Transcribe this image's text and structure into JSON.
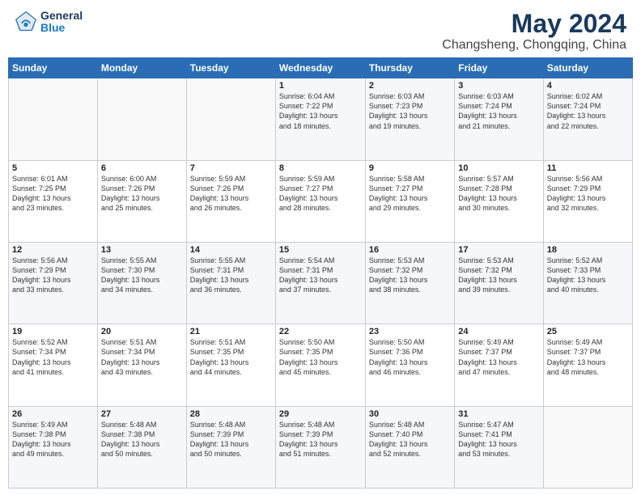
{
  "header": {
    "logo_general": "General",
    "logo_blue": "Blue",
    "month": "May 2024",
    "location": "Changsheng, Chongqing, China"
  },
  "calendar": {
    "weekdays": [
      "Sunday",
      "Monday",
      "Tuesday",
      "Wednesday",
      "Thursday",
      "Friday",
      "Saturday"
    ],
    "weeks": [
      [
        {
          "day": "",
          "info": ""
        },
        {
          "day": "",
          "info": ""
        },
        {
          "day": "",
          "info": ""
        },
        {
          "day": "1",
          "info": "Sunrise: 6:04 AM\nSunset: 7:22 PM\nDaylight: 13 hours\nand 18 minutes."
        },
        {
          "day": "2",
          "info": "Sunrise: 6:03 AM\nSunset: 7:23 PM\nDaylight: 13 hours\nand 19 minutes."
        },
        {
          "day": "3",
          "info": "Sunrise: 6:03 AM\nSunset: 7:24 PM\nDaylight: 13 hours\nand 21 minutes."
        },
        {
          "day": "4",
          "info": "Sunrise: 6:02 AM\nSunset: 7:24 PM\nDaylight: 13 hours\nand 22 minutes."
        }
      ],
      [
        {
          "day": "5",
          "info": "Sunrise: 6:01 AM\nSunset: 7:25 PM\nDaylight: 13 hours\nand 23 minutes."
        },
        {
          "day": "6",
          "info": "Sunrise: 6:00 AM\nSunset: 7:26 PM\nDaylight: 13 hours\nand 25 minutes."
        },
        {
          "day": "7",
          "info": "Sunrise: 5:59 AM\nSunset: 7:26 PM\nDaylight: 13 hours\nand 26 minutes."
        },
        {
          "day": "8",
          "info": "Sunrise: 5:59 AM\nSunset: 7:27 PM\nDaylight: 13 hours\nand 28 minutes."
        },
        {
          "day": "9",
          "info": "Sunrise: 5:58 AM\nSunset: 7:27 PM\nDaylight: 13 hours\nand 29 minutes."
        },
        {
          "day": "10",
          "info": "Sunrise: 5:57 AM\nSunset: 7:28 PM\nDaylight: 13 hours\nand 30 minutes."
        },
        {
          "day": "11",
          "info": "Sunrise: 5:56 AM\nSunset: 7:29 PM\nDaylight: 13 hours\nand 32 minutes."
        }
      ],
      [
        {
          "day": "12",
          "info": "Sunrise: 5:56 AM\nSunset: 7:29 PM\nDaylight: 13 hours\nand 33 minutes."
        },
        {
          "day": "13",
          "info": "Sunrise: 5:55 AM\nSunset: 7:30 PM\nDaylight: 13 hours\nand 34 minutes."
        },
        {
          "day": "14",
          "info": "Sunrise: 5:55 AM\nSunset: 7:31 PM\nDaylight: 13 hours\nand 36 minutes."
        },
        {
          "day": "15",
          "info": "Sunrise: 5:54 AM\nSunset: 7:31 PM\nDaylight: 13 hours\nand 37 minutes."
        },
        {
          "day": "16",
          "info": "Sunrise: 5:53 AM\nSunset: 7:32 PM\nDaylight: 13 hours\nand 38 minutes."
        },
        {
          "day": "17",
          "info": "Sunrise: 5:53 AM\nSunset: 7:32 PM\nDaylight: 13 hours\nand 39 minutes."
        },
        {
          "day": "18",
          "info": "Sunrise: 5:52 AM\nSunset: 7:33 PM\nDaylight: 13 hours\nand 40 minutes."
        }
      ],
      [
        {
          "day": "19",
          "info": "Sunrise: 5:52 AM\nSunset: 7:34 PM\nDaylight: 13 hours\nand 41 minutes."
        },
        {
          "day": "20",
          "info": "Sunrise: 5:51 AM\nSunset: 7:34 PM\nDaylight: 13 hours\nand 43 minutes."
        },
        {
          "day": "21",
          "info": "Sunrise: 5:51 AM\nSunset: 7:35 PM\nDaylight: 13 hours\nand 44 minutes."
        },
        {
          "day": "22",
          "info": "Sunrise: 5:50 AM\nSunset: 7:35 PM\nDaylight: 13 hours\nand 45 minutes."
        },
        {
          "day": "23",
          "info": "Sunrise: 5:50 AM\nSunset: 7:36 PM\nDaylight: 13 hours\nand 46 minutes."
        },
        {
          "day": "24",
          "info": "Sunrise: 5:49 AM\nSunset: 7:37 PM\nDaylight: 13 hours\nand 47 minutes."
        },
        {
          "day": "25",
          "info": "Sunrise: 5:49 AM\nSunset: 7:37 PM\nDaylight: 13 hours\nand 48 minutes."
        }
      ],
      [
        {
          "day": "26",
          "info": "Sunrise: 5:49 AM\nSunset: 7:38 PM\nDaylight: 13 hours\nand 49 minutes."
        },
        {
          "day": "27",
          "info": "Sunrise: 5:48 AM\nSunset: 7:38 PM\nDaylight: 13 hours\nand 50 minutes."
        },
        {
          "day": "28",
          "info": "Sunrise: 5:48 AM\nSunset: 7:39 PM\nDaylight: 13 hours\nand 50 minutes."
        },
        {
          "day": "29",
          "info": "Sunrise: 5:48 AM\nSunset: 7:39 PM\nDaylight: 13 hours\nand 51 minutes."
        },
        {
          "day": "30",
          "info": "Sunrise: 5:48 AM\nSunset: 7:40 PM\nDaylight: 13 hours\nand 52 minutes."
        },
        {
          "day": "31",
          "info": "Sunrise: 5:47 AM\nSunset: 7:41 PM\nDaylight: 13 hours\nand 53 minutes."
        },
        {
          "day": "",
          "info": ""
        }
      ]
    ]
  }
}
